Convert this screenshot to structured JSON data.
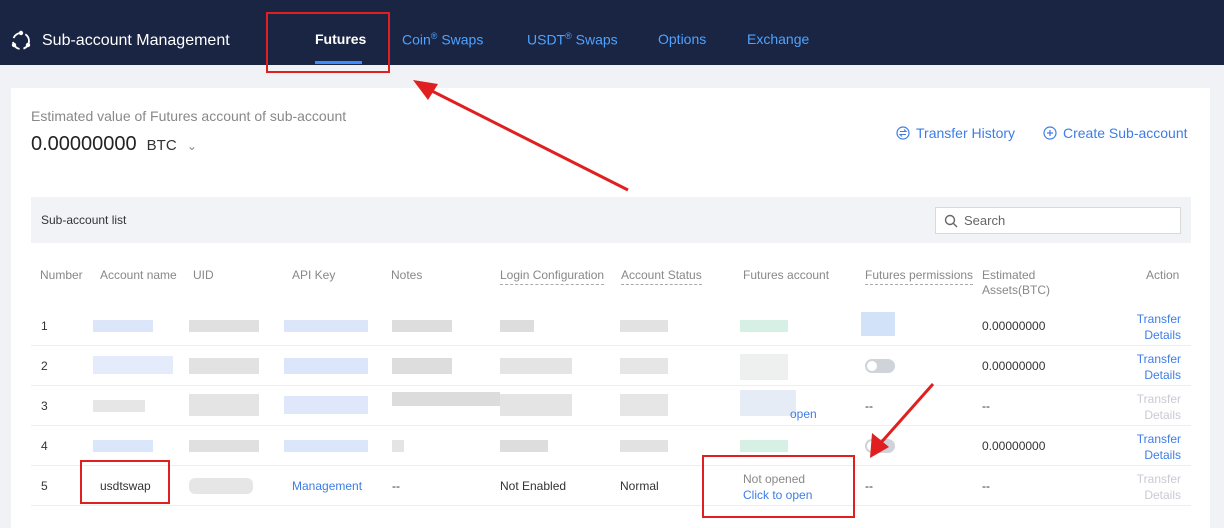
{
  "header": {
    "title": "Sub-account Management",
    "tabs": [
      {
        "label": "Futures"
      },
      {
        "label": "Coin",
        "suffix": " Swaps"
      },
      {
        "label": "USDT",
        "suffix": " Swaps"
      },
      {
        "label": "Options"
      },
      {
        "label": "Exchange"
      }
    ],
    "registered_mark": "®"
  },
  "summary": {
    "label": "Estimated value of Futures account of sub-account",
    "value": "0.00000000",
    "unit": "BTC",
    "transfer_history": "Transfer History",
    "create_sub_account": "Create Sub-account"
  },
  "list": {
    "title": "Sub-account list",
    "search_placeholder": "Search",
    "columns": {
      "number": "Number",
      "account_name": "Account name",
      "uid": "UID",
      "api_key": "API Key",
      "notes": "Notes",
      "login_config": "Login Configuration",
      "account_status": "Account Status",
      "futures_account": "Futures account",
      "futures_permissions": "Futures permissions",
      "estimated_assets_1": "Estimated",
      "estimated_assets_2": "Assets(BTC)",
      "action": "Action"
    },
    "rows": [
      {
        "number": "1",
        "assets": "0.00000000",
        "transfer": "Transfer",
        "details": "Details"
      },
      {
        "number": "2",
        "assets": "0.00000000",
        "transfer": "Transfer",
        "details": "Details"
      },
      {
        "number": "3",
        "assets": "--",
        "perm": "--",
        "open_fragment": "open",
        "transfer": "Transfer",
        "details": "Details"
      },
      {
        "number": "4",
        "assets": "0.00000000",
        "transfer": "Transfer",
        "details": "Details"
      },
      {
        "number": "5",
        "account_name": "usdtswap",
        "api_key": "Management",
        "notes": "--",
        "login_config": "Not Enabled",
        "status": "Normal",
        "futures_status": "Not opened",
        "futures_action": "Click to open",
        "perm": "--",
        "assets": "--",
        "transfer": "Transfer",
        "details": "Details"
      }
    ]
  },
  "colors": {
    "nav_bg": "#1a2443",
    "accent": "#3d7de6",
    "highlight": "#e02020"
  }
}
